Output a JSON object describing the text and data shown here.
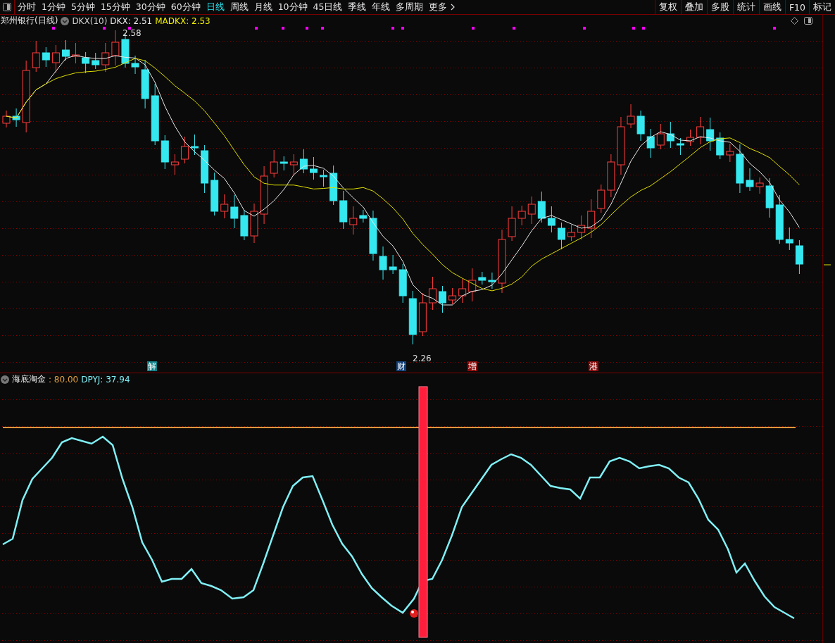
{
  "toolbar": {
    "tabs": [
      {
        "label": "分时",
        "selected": false
      },
      {
        "label": "1分钟",
        "selected": false
      },
      {
        "label": "5分钟",
        "selected": false
      },
      {
        "label": "15分钟",
        "selected": false
      },
      {
        "label": "30分钟",
        "selected": false
      },
      {
        "label": "60分钟",
        "selected": false
      },
      {
        "label": "日线",
        "selected": true
      },
      {
        "label": "周线",
        "selected": false
      },
      {
        "label": "月线",
        "selected": false
      },
      {
        "label": "10分钟",
        "selected": false
      },
      {
        "label": "45日线",
        "selected": false
      },
      {
        "label": "季线",
        "selected": false
      },
      {
        "label": "年线",
        "selected": false
      },
      {
        "label": "多周期",
        "selected": false
      }
    ],
    "more": "更多",
    "buttons": [
      "复权",
      "叠加",
      "多股",
      "统计",
      "画线",
      "F10",
      "标记"
    ]
  },
  "main_chart": {
    "title": "郑州银行(日线)",
    "indicator": "DKX(10)",
    "dkx": "DKX: 2.51",
    "madkx": "MADKX: 2.53",
    "high_label": "2.58",
    "low_label": "2.26",
    "events": [
      {
        "label": "解",
        "color": "#0e7f86"
      },
      {
        "label": "财",
        "color": "#12407a"
      },
      {
        "label": "增",
        "color": "#8a0c0c"
      },
      {
        "label": "港",
        "color": "#8a0c0c"
      }
    ]
  },
  "sub_chart": {
    "title": "海底淘金",
    "level_text": ": 80.00",
    "value": "DPYJ: 37.94"
  }
}
